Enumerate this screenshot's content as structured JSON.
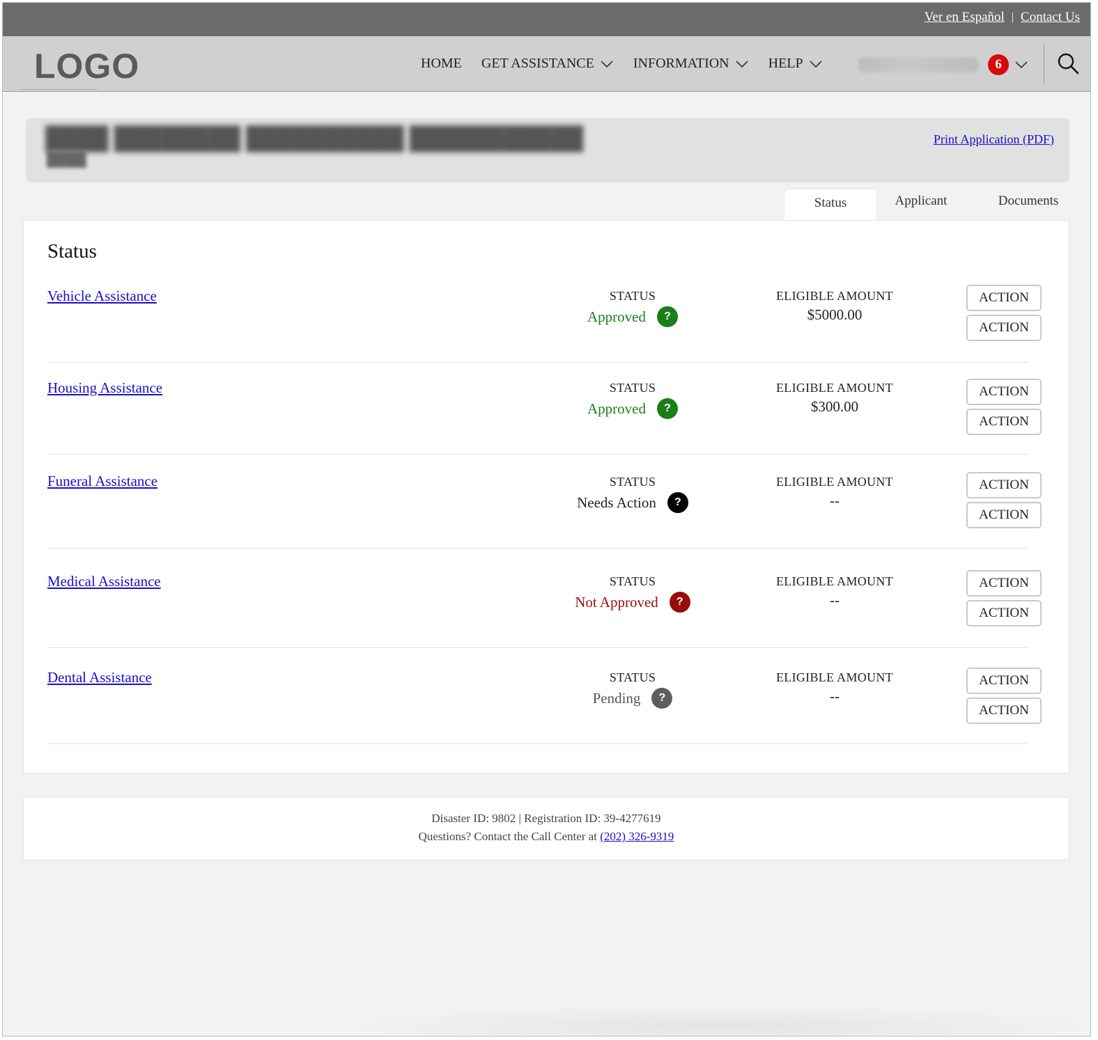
{
  "utility": {
    "spanish_link": "Ver en Español",
    "separator": "|",
    "contact_link": "Contact Us"
  },
  "header": {
    "logo": "LOGO",
    "nav": {
      "home": "HOME",
      "get_assistance": "GET ASSISTANCE",
      "information": "INFORMATION",
      "help": "HELP"
    },
    "notification_count": "6"
  },
  "application": {
    "print_link": "Print Application (PDF)"
  },
  "tabs": {
    "status": "Status",
    "applicant": "Applicant",
    "documents": "Documents"
  },
  "panel": {
    "heading": "Status",
    "status_label": "STATUS",
    "amount_label": "ELIGIBLE AMOUNT",
    "action_label": "ACTION",
    "help_glyph": "?",
    "rows": [
      {
        "name": "Vehicle Assistance",
        "status": "Approved",
        "status_color": "#1a7f1a",
        "icon_color": "#1a7f1a",
        "amount": "$5000.00"
      },
      {
        "name": "Housing Assistance",
        "status": "Approved",
        "status_color": "#1a7f1a",
        "icon_color": "#1a7f1a",
        "amount": "$300.00"
      },
      {
        "name": "Funeral Assistance",
        "status": "Needs Action",
        "status_color": "#222222",
        "icon_color": "#000000",
        "amount": "--"
      },
      {
        "name": "Medical Assistance",
        "status": "Not Approved",
        "status_color": "#9a0b0b",
        "icon_color": "#9a0b0b",
        "amount": "--"
      },
      {
        "name": "Dental Assistance",
        "status": "Pending",
        "status_color": "#555555",
        "icon_color": "#5e5e5e",
        "amount": "--"
      }
    ]
  },
  "footer": {
    "ids": "Disaster ID: 9802 | Registration ID: 39-4277619",
    "questions": "Questions? Contact the Call Center at",
    "phone": "(202) 326-9319"
  },
  "colors": {
    "link": "#1a0dcc",
    "badge": "#d40b0b",
    "utility_bar": "#6b6b6b",
    "header_bg": "#d0d0d0"
  }
}
